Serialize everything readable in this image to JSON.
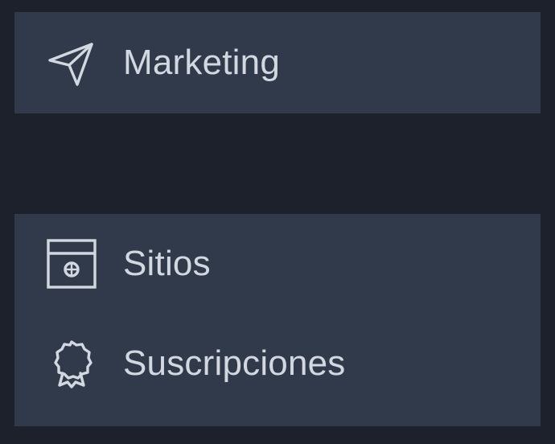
{
  "menu": {
    "group_top": [
      {
        "label": "Marketing",
        "icon": "send-icon"
      }
    ],
    "group_bottom": [
      {
        "label": "Sitios",
        "icon": "website-icon"
      },
      {
        "label": "Suscripciones",
        "icon": "badge-icon"
      }
    ]
  },
  "colors": {
    "background": "#1d212b",
    "panel": "#303a4a",
    "text": "#d3d8e0",
    "icon": "#d3d8e0"
  }
}
